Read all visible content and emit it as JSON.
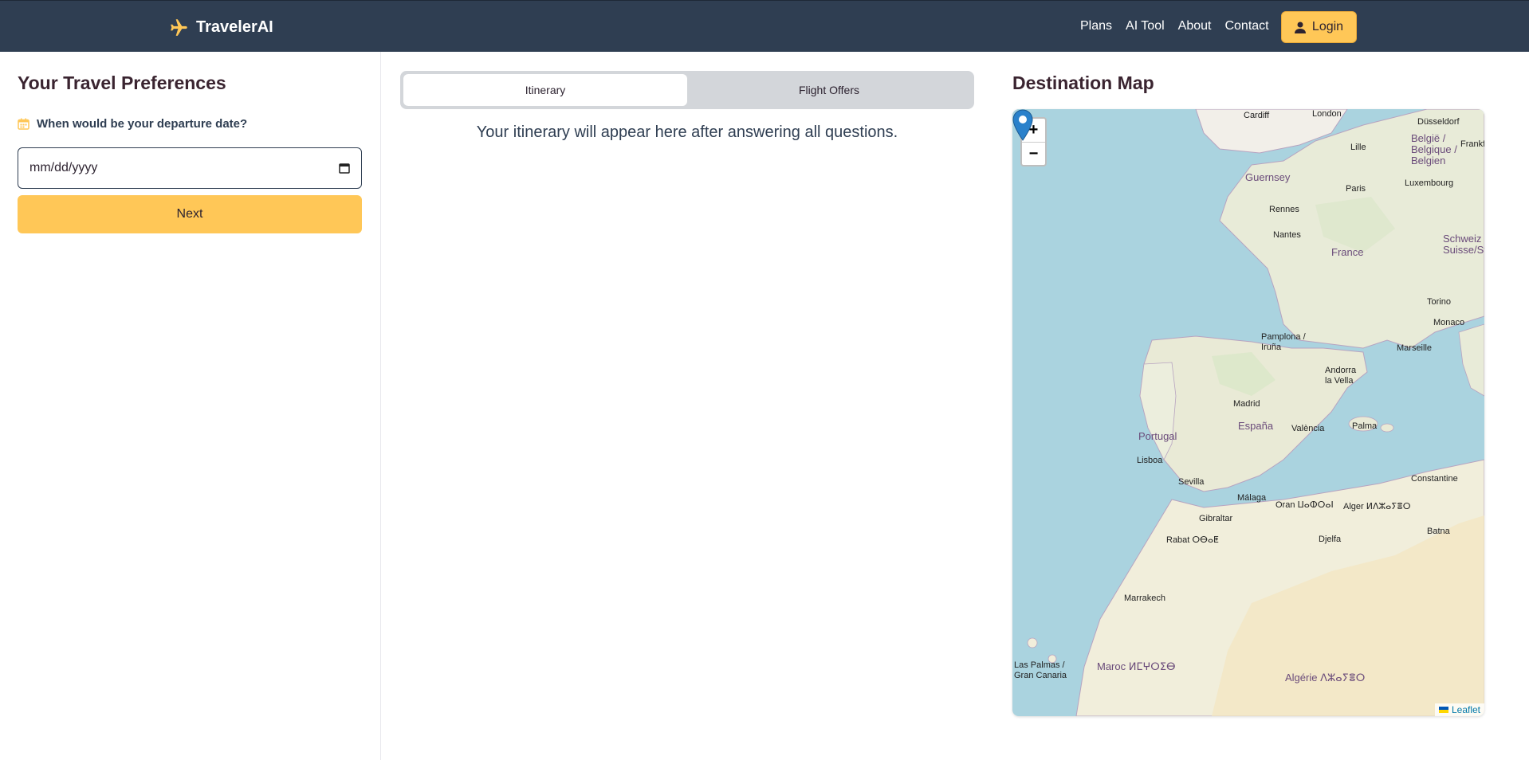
{
  "header": {
    "brand": "TravelerAI",
    "nav": [
      "Plans",
      "AI Tool",
      "About",
      "Contact"
    ],
    "login_label": "Login",
    "accent_color": "#ffc757",
    "bg_color": "#2f3e52"
  },
  "preferences": {
    "title": "Your Travel Preferences",
    "question": "When would be your departure date?",
    "date_placeholder": "mm/dd/yyyy",
    "next_label": "Next"
  },
  "tabs": [
    {
      "label": "Itinerary",
      "active": true
    },
    {
      "label": "Flight Offers",
      "active": false
    }
  ],
  "itinerary_message": "Your itinerary will appear here after answering all questions.",
  "map": {
    "title": "Destination Map",
    "zoom_in": "+",
    "zoom_out": "−",
    "attribution": "Leaflet",
    "labels": {
      "cardiff": "Cardiff",
      "london": "London",
      "dusseldorf": "Düsseldorf",
      "belgie": "België / Belgique / Belgien",
      "frankfurt": "Frankfu",
      "lille": "Lille",
      "guernsey": "Guernsey",
      "paris": "Paris",
      "luxembourg": "Luxembourg",
      "rennes": "Rennes",
      "nantes": "Nantes",
      "france": "France",
      "pamplona": "Pamplona / Iruña",
      "marseille": "Marseille",
      "monaco": "Monaco",
      "andorra": "Andorra la Vella",
      "madrid": "Madrid",
      "espana": "España",
      "valencia": "València",
      "palma": "Palma",
      "portugal": "Portugal",
      "lisboa": "Lisboa",
      "sevilla": "Sevilla",
      "malaga": "Málaga",
      "gibraltar": "Gibraltar",
      "rabat": "Rabat ⵔⴱⴰⵟ",
      "oran": "Oran ⵡⴰⵀⵔⴰⵏ",
      "alger": "Alger ⵍⴷⵣⴰⵢⴻⵔ",
      "constantine": "Constantine",
      "batna": "Batna",
      "djelfa": "Djelfa",
      "marrakech": "Marrakech",
      "maroc": "Maroc ⵍⵎⵖⵔⵉⴱ",
      "algerie": "Algérie ⴷⵣⴰⵢⴻⵔ",
      "laspalmas": "Las Palmas / Gran Canaria",
      "torino": "Torino",
      "schweiz": "Schweiz / Suisse/Sviz"
    }
  }
}
